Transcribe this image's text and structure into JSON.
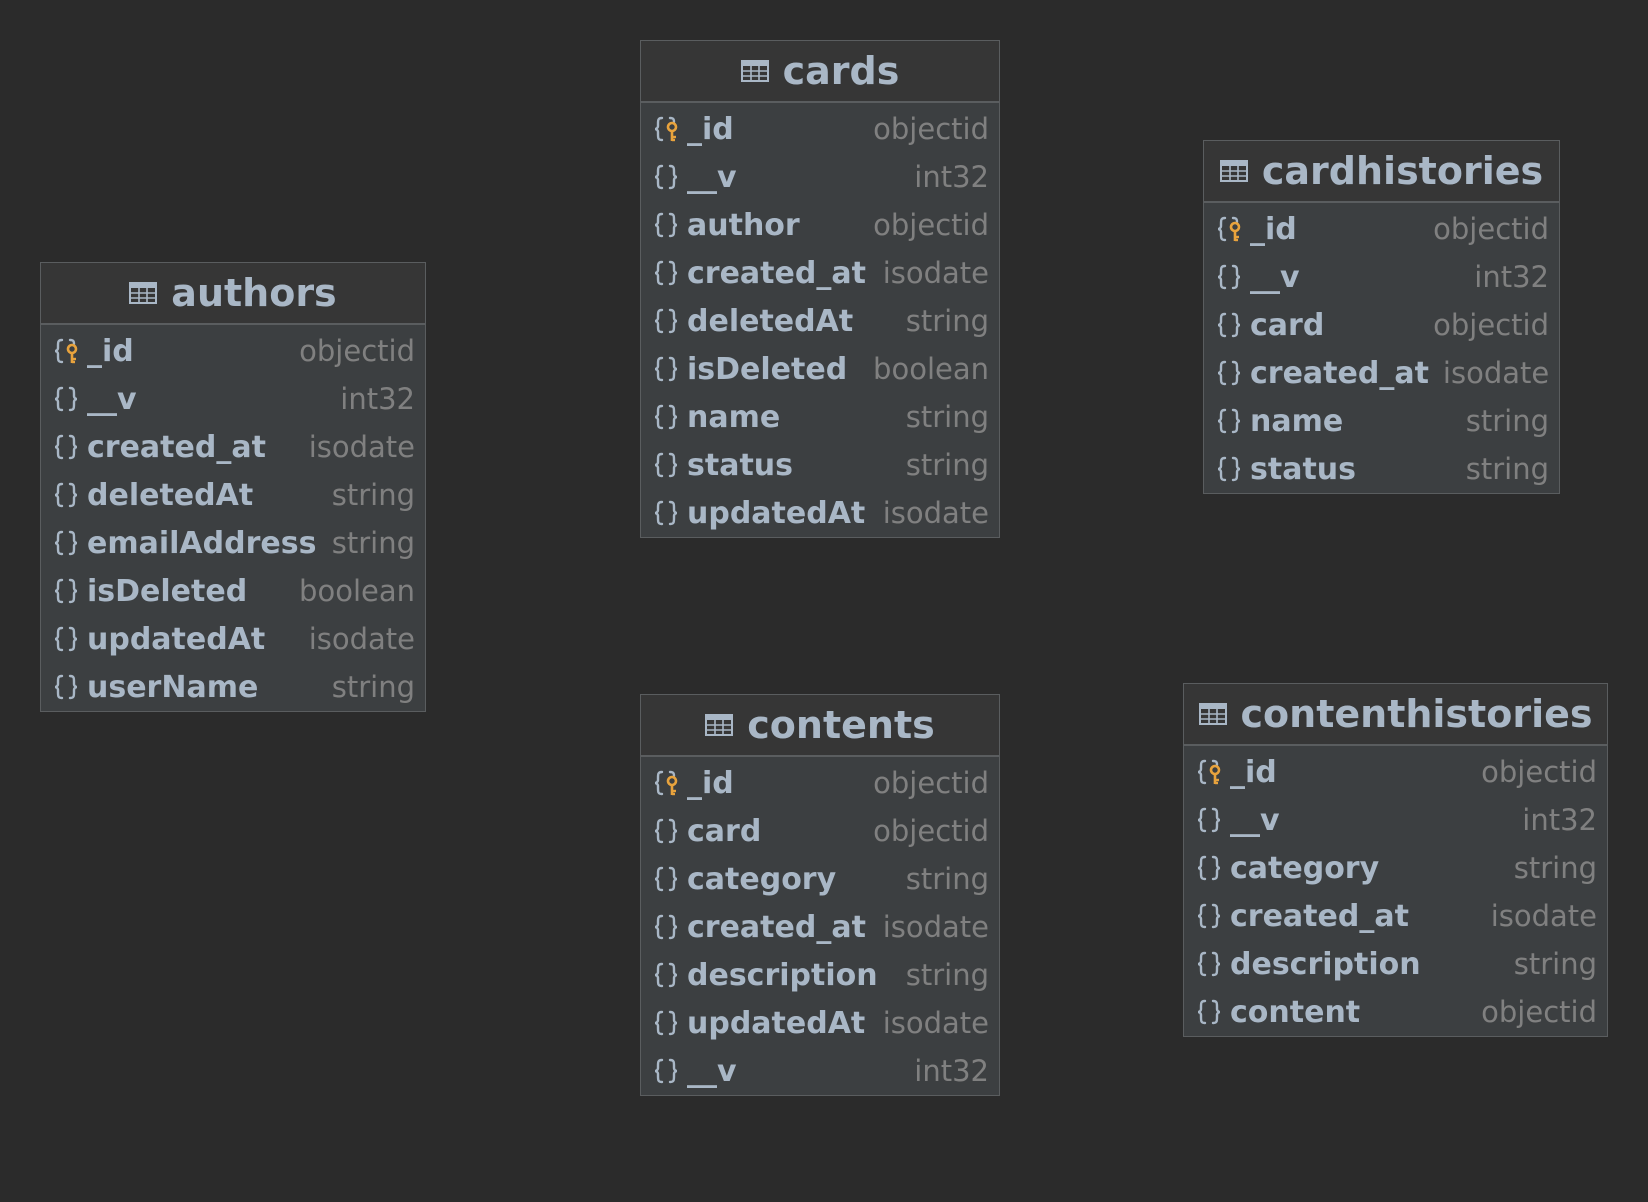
{
  "tables": [
    {
      "id": "authors",
      "title": "authors",
      "fields": [
        {
          "name": "_id",
          "type": "objectid",
          "key": true
        },
        {
          "name": "__v",
          "type": "int32"
        },
        {
          "name": "created_at",
          "type": "isodate"
        },
        {
          "name": "deletedAt",
          "type": "string"
        },
        {
          "name": "emailAddress",
          "type": "string"
        },
        {
          "name": "isDeleted",
          "type": "boolean"
        },
        {
          "name": "updatedAt",
          "type": "isodate"
        },
        {
          "name": "userName",
          "type": "string"
        }
      ]
    },
    {
      "id": "cards",
      "title": "cards",
      "fields": [
        {
          "name": "_id",
          "type": "objectid",
          "key": true
        },
        {
          "name": "__v",
          "type": "int32"
        },
        {
          "name": "author",
          "type": "objectid"
        },
        {
          "name": "created_at",
          "type": "isodate"
        },
        {
          "name": "deletedAt",
          "type": "string"
        },
        {
          "name": "isDeleted",
          "type": "boolean"
        },
        {
          "name": "name",
          "type": "string"
        },
        {
          "name": "status",
          "type": "string"
        },
        {
          "name": "updatedAt",
          "type": "isodate"
        }
      ]
    },
    {
      "id": "cardhistories",
      "title": "cardhistories",
      "fields": [
        {
          "name": "_id",
          "type": "objectid",
          "key": true
        },
        {
          "name": "__v",
          "type": "int32"
        },
        {
          "name": "card",
          "type": "objectid"
        },
        {
          "name": "created_at",
          "type": "isodate"
        },
        {
          "name": "name",
          "type": "string"
        },
        {
          "name": "status",
          "type": "string"
        }
      ]
    },
    {
      "id": "contents",
      "title": "contents",
      "fields": [
        {
          "name": "_id",
          "type": "objectid",
          "key": true
        },
        {
          "name": "card",
          "type": "objectid"
        },
        {
          "name": "category",
          "type": "string"
        },
        {
          "name": "created_at",
          "type": "isodate"
        },
        {
          "name": "description",
          "type": "string"
        },
        {
          "name": "updatedAt",
          "type": "isodate"
        },
        {
          "name": "__v",
          "type": "int32"
        }
      ]
    },
    {
      "id": "contenthistories",
      "title": "contenthistories",
      "fields": [
        {
          "name": "_id",
          "type": "objectid",
          "key": true
        },
        {
          "name": "__v",
          "type": "int32"
        },
        {
          "name": "category",
          "type": "string"
        },
        {
          "name": "created_at",
          "type": "isodate"
        },
        {
          "name": "description",
          "type": "string"
        },
        {
          "name": "content",
          "type": "objectid"
        }
      ]
    }
  ],
  "icons": {
    "table": "table-grid-icon",
    "field": "curly-braces-icon",
    "primary_key": "key-icon"
  },
  "colors": {
    "background": "#2b2b2b",
    "table_body": "#3c3f41",
    "table_header": "#363636",
    "border": "#5a5d5f",
    "field_name": "#a9b7c6",
    "field_type": "#808080",
    "key_accent": "#e8a33d"
  }
}
